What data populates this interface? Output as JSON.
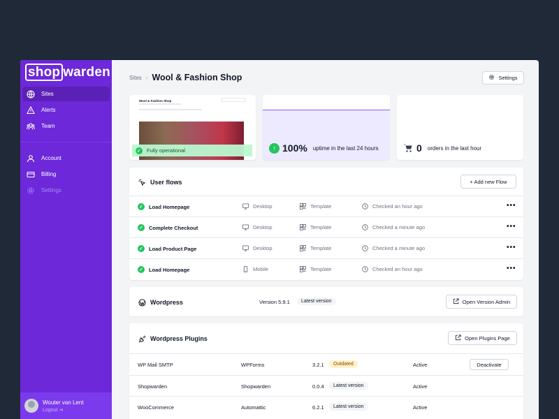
{
  "brand": {
    "logo_boxed": "shop",
    "logo_rest": "warden"
  },
  "sidebar": {
    "items": [
      {
        "label": "Sites"
      },
      {
        "label": "Alerts"
      },
      {
        "label": "Team"
      },
      {
        "label": "Account"
      },
      {
        "label": "Billing"
      },
      {
        "label": "Settings"
      }
    ],
    "user": {
      "name": "Wouter van Lent",
      "logout": "Logout"
    }
  },
  "header": {
    "breadcrumb": "Sites",
    "title": "Wool & Fashion Shop",
    "settings_label": "Settings"
  },
  "site_preview": {
    "site_title": "Wool & Fashion Shop",
    "status": "Fully operational"
  },
  "uptime": {
    "value": "100%",
    "label": "uptime in the last 24 hours"
  },
  "orders": {
    "value": "0",
    "label": "orders in the last hour"
  },
  "flows": {
    "title": "User flows",
    "add_label": "+ Add new Flow",
    "rows": [
      {
        "name": "Load Homepage",
        "device": "Desktop",
        "template": "Template",
        "checked": "Checked an hour ago"
      },
      {
        "name": "Complete Checkout",
        "device": "Desktop",
        "template": "Template",
        "checked": "Checked a minute ago"
      },
      {
        "name": "Load Product Page",
        "device": "Desktop",
        "template": "Template",
        "checked": "Checked a minute ago"
      },
      {
        "name": "Load Homepage",
        "device": "Mobile",
        "template": "Template",
        "checked": "Checked an hour ago"
      }
    ]
  },
  "wordpress": {
    "title": "Wordpress",
    "version": "Version 5.9.1",
    "badge": "Latest version",
    "button": "Open Version Admin"
  },
  "plugins": {
    "title": "Wordpress Plugins",
    "button": "Open Plugins Page",
    "rows": [
      {
        "name": "WP Mail SMTP",
        "author": "WPForms",
        "version": "3.2.1",
        "badge": "Outdated",
        "status": "Active",
        "action": "Deactivate"
      },
      {
        "name": "Shopwarden",
        "author": "Shopwarden",
        "version": "0.0.4",
        "badge": "Latest version",
        "status": "Active"
      },
      {
        "name": "WooCommerce",
        "author": "Automattic",
        "version": "6.2.1",
        "badge": "Latest version",
        "status": "Active"
      }
    ]
  },
  "colors": {
    "accent": "#6d28d9",
    "success": "#22c55e",
    "warning": "#fef3c7"
  }
}
